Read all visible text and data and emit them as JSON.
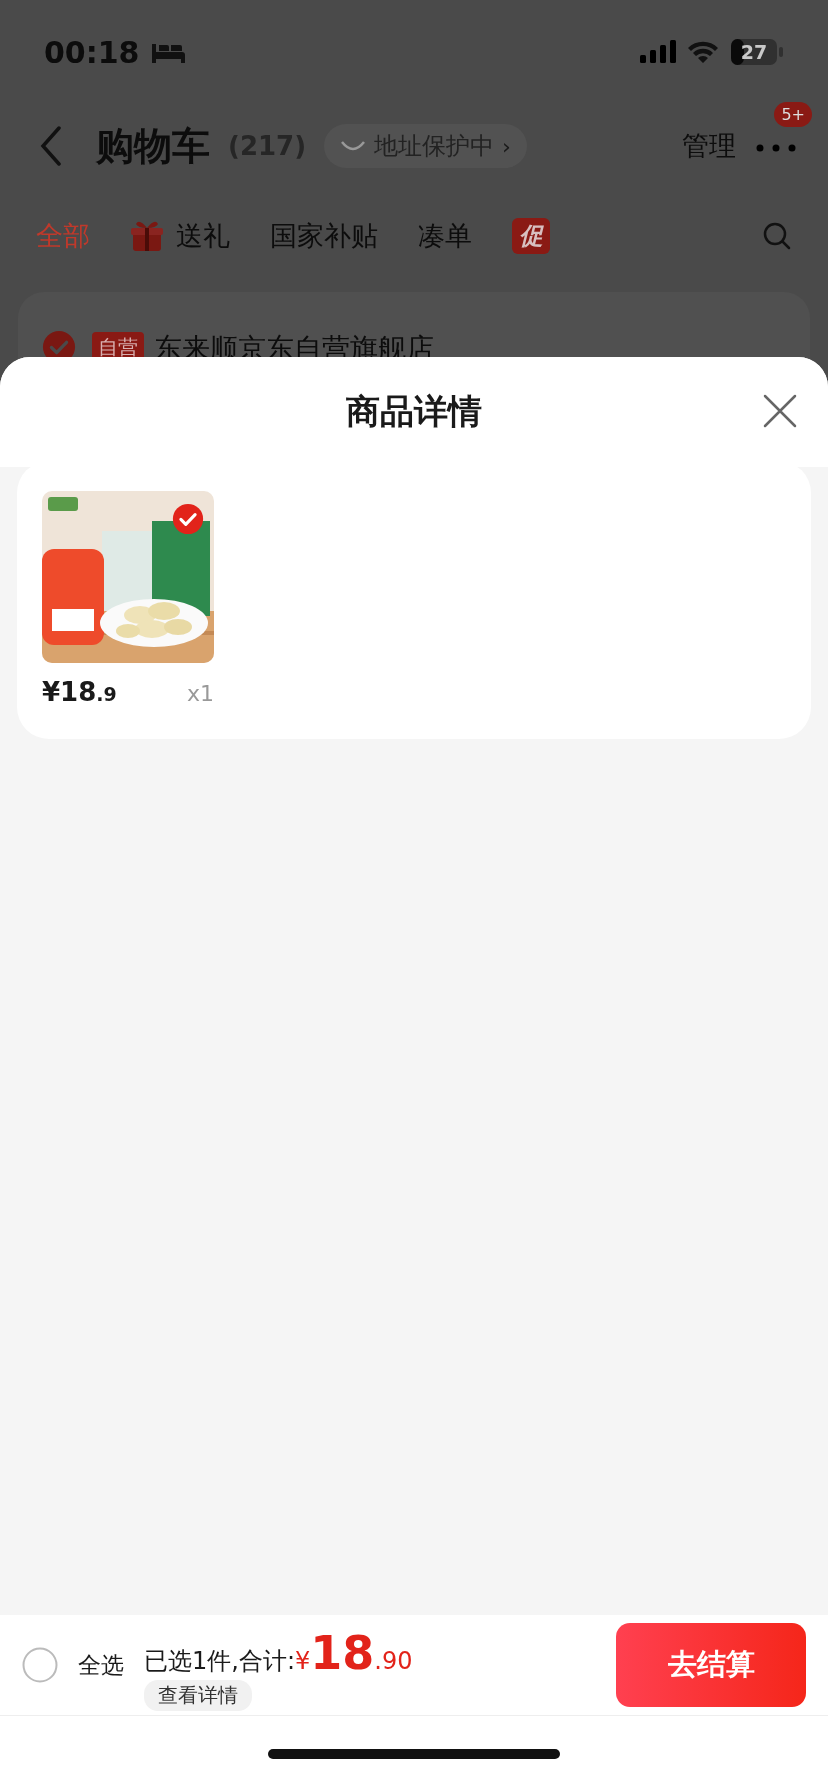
{
  "status_bar": {
    "time": "00:18",
    "battery": "27"
  },
  "header": {
    "title": "购物车",
    "count": "(217)",
    "address_badge": "地址保护中",
    "address_arrow": "›",
    "manage": "管理",
    "more_badge": "5+"
  },
  "tabs": [
    {
      "label": "全部",
      "selected": true,
      "kind": "text"
    },
    {
      "label": "送礼",
      "selected": false,
      "kind": "gift"
    },
    {
      "label": "国家补贴",
      "selected": false,
      "kind": "text"
    },
    {
      "label": "凑单",
      "selected": false,
      "kind": "text"
    },
    {
      "label": "促",
      "selected": false,
      "kind": "badge"
    }
  ],
  "store": {
    "checked": true,
    "tag": "自营",
    "name": "东来顺京东自营旗舰店"
  },
  "sheet": {
    "title": "商品详情",
    "items": [
      {
        "kind": "picture",
        "checked": true,
        "price": "¥18",
        "price_decimal": ".9",
        "quantity": "x1"
      }
    ]
  },
  "footer": {
    "select_all": {
      "label": "全选",
      "checked": false
    },
    "summary": "已选1件,合计:",
    "currency": "¥",
    "total": "18",
    "total_decimal": ".90",
    "details": "查看详情",
    "checkout": "去结算"
  }
}
